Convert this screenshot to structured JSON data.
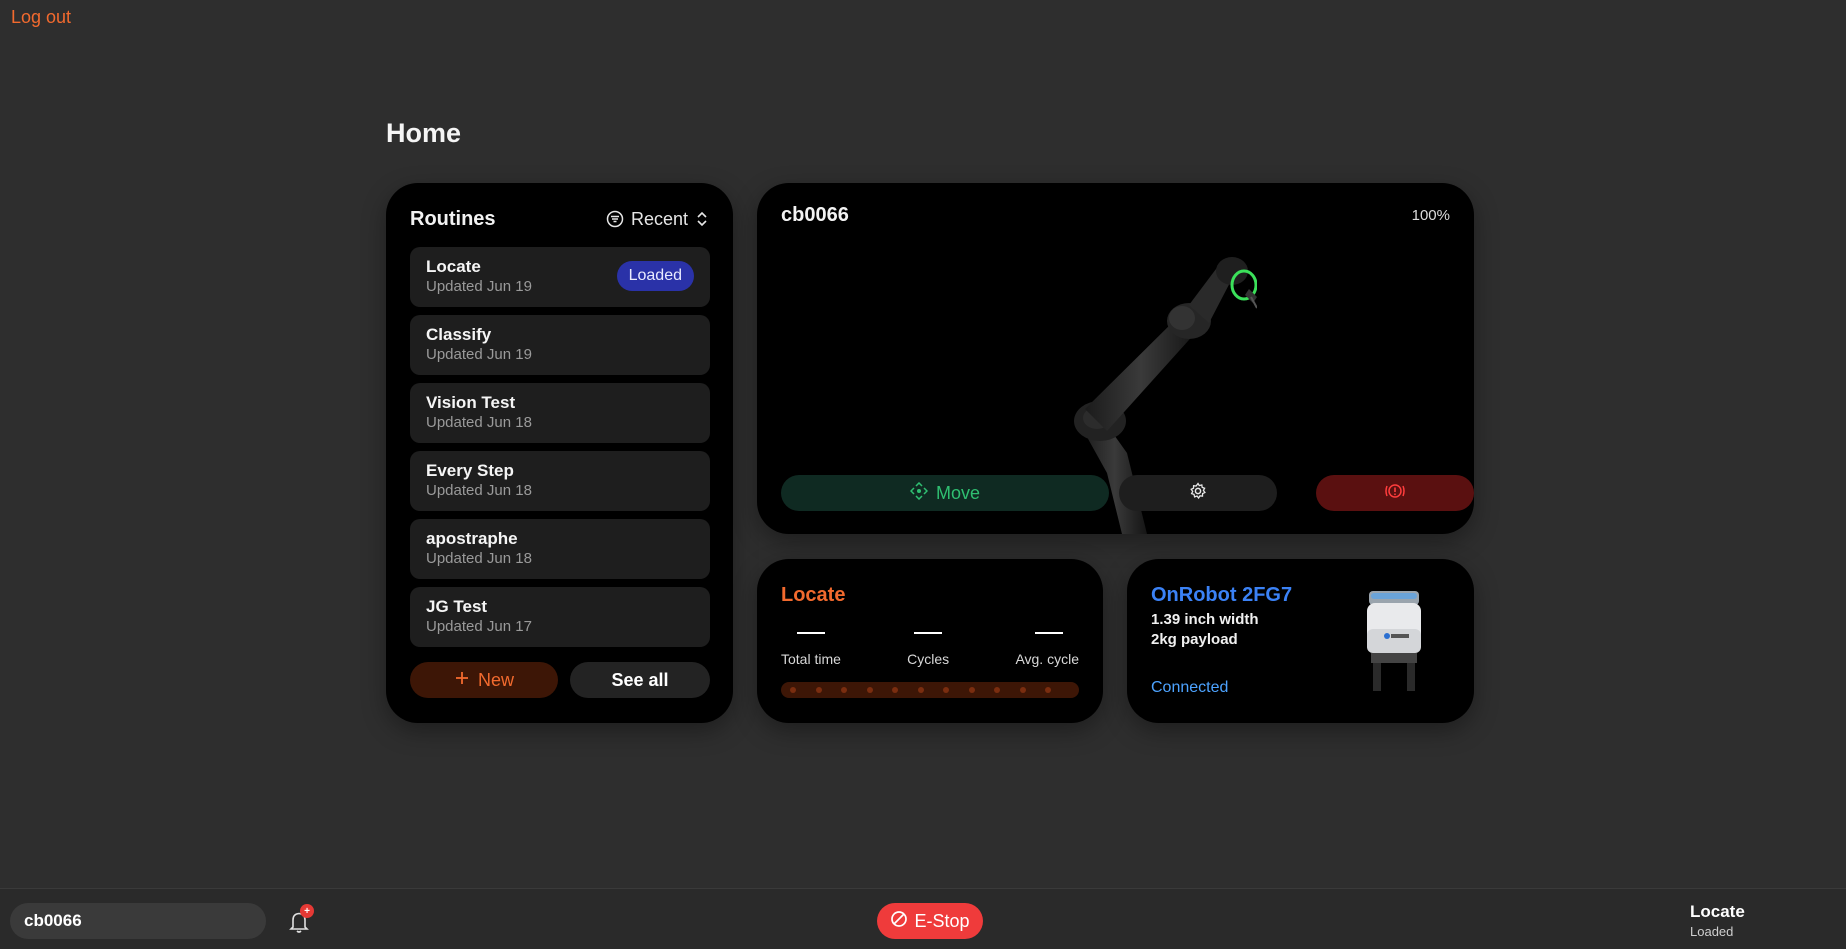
{
  "header": {
    "logout_label": "Log out"
  },
  "page": {
    "title": "Home"
  },
  "routines": {
    "title": "Routines",
    "sort_label": "Recent",
    "items": [
      {
        "name": "Locate",
        "updated": "Updated Jun 19",
        "badge": "Loaded"
      },
      {
        "name": "Classify",
        "updated": "Updated Jun 19"
      },
      {
        "name": "Vision Test",
        "updated": "Updated Jun 18"
      },
      {
        "name": "Every Step",
        "updated": "Updated Jun 18"
      },
      {
        "name": "apostraphe",
        "updated": "Updated Jun 18"
      },
      {
        "name": "JG Test",
        "updated": "Updated Jun 17"
      }
    ],
    "new_label": "New",
    "see_all_label": "See all"
  },
  "robot": {
    "name": "cb0066",
    "percent": "100%",
    "move_label": "Move"
  },
  "locate_card": {
    "title": "Locate",
    "stats": [
      {
        "label": "Total time"
      },
      {
        "label": "Cycles"
      },
      {
        "label": "Avg. cycle"
      }
    ],
    "progress": 0
  },
  "gripper": {
    "title": "OnRobot 2FG7",
    "width": "1.39 inch width",
    "payload": "2kg payload",
    "status": "Connected"
  },
  "bottombar": {
    "robot_select": "cb0066",
    "notification_count": "+",
    "estop_label": "E-Stop",
    "status_title": "Locate",
    "status_sub": "Loaded"
  },
  "colors": {
    "accent": "#f26a2e",
    "move_green": "#2fbf71",
    "gripper_blue": "#3b82f6",
    "estop_red": "#ef3b3b",
    "badge_blue": "#2a32a8"
  }
}
